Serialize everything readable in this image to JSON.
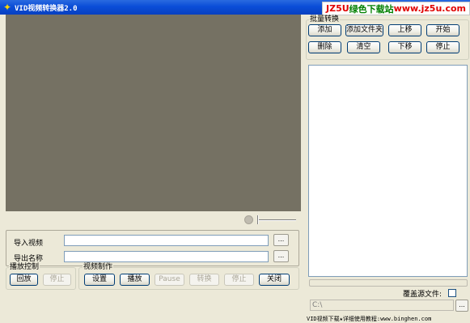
{
  "window": {
    "title": "VID视频转换器2.0"
  },
  "watermark": {
    "part1": "JZ5U",
    "part2": "绿色下载站",
    "part3": "www.jz5u.com"
  },
  "io": {
    "import_label": "导入视频",
    "export_label": "导出名称",
    "import_value": "",
    "export_value": "",
    "browse_label": "..."
  },
  "playback": {
    "title": "播放控制",
    "buttons": {
      "rewind": "回放",
      "stop": "停止"
    }
  },
  "production": {
    "title": "视频制作",
    "buttons": {
      "settings": "设置",
      "play": "播放",
      "pause": "Pause",
      "convert": "转换",
      "stop": "停止",
      "close": "关闭"
    }
  },
  "batch": {
    "title": "批量转换",
    "buttons": {
      "add": "添加",
      "add_folder": "添加文件夹",
      "move_up": "上移",
      "start": "开始",
      "delete": "删除",
      "clear": "清空",
      "move_down": "下移",
      "stop": "停止"
    },
    "overwrite_label": "覆盖源文件:",
    "overwrite_checked": false,
    "output_path": "C:\\",
    "browse_label": "..."
  },
  "status": {
    "text": "VID视频下载★详细使用教程:www.binghen.com"
  }
}
